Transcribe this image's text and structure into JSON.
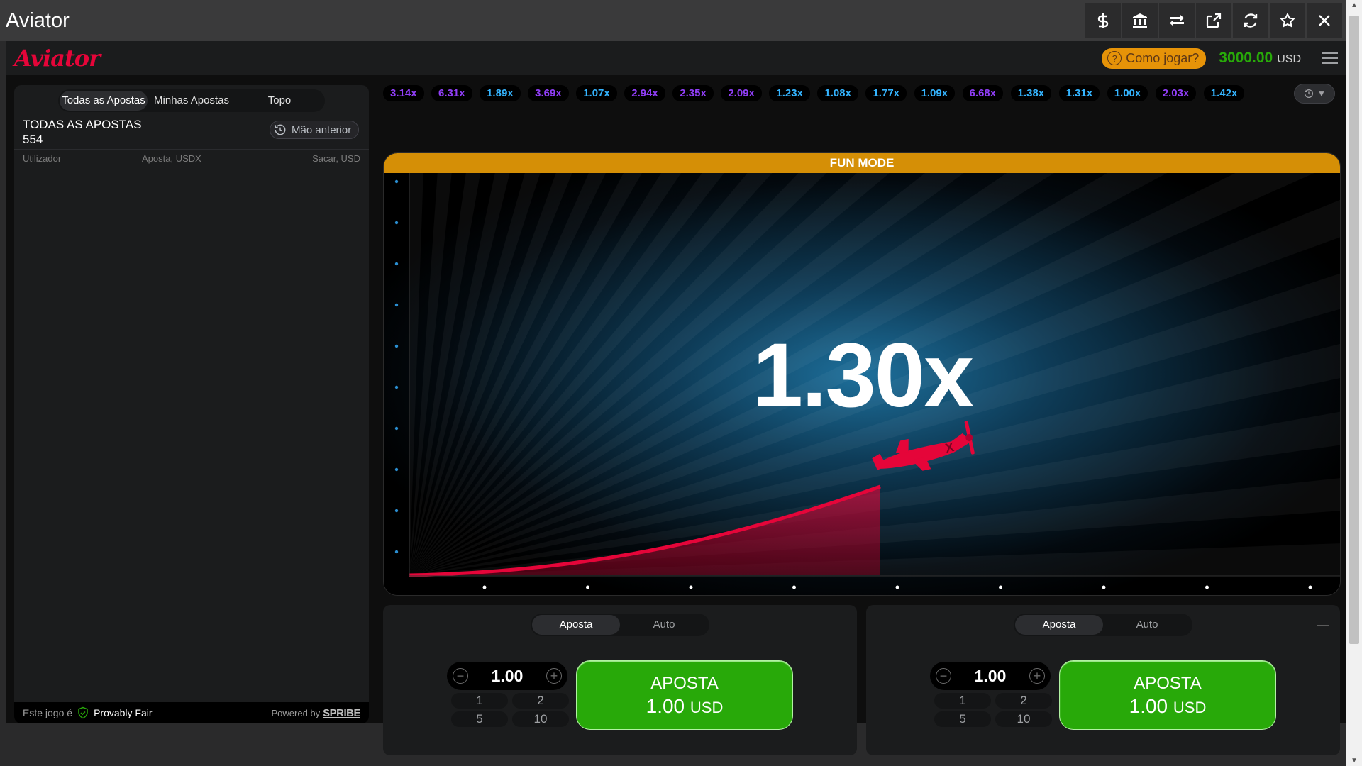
{
  "window": {
    "title": "Aviator",
    "actions": [
      "dollar-icon",
      "bank-icon",
      "swap-icon",
      "external-link-icon",
      "refresh-icon",
      "star-icon",
      "close-icon"
    ]
  },
  "header": {
    "logo": "Aviator",
    "how_to_play": "Como jogar?",
    "balance": "3000.00",
    "currency": "USD"
  },
  "left_panel": {
    "tabs": [
      {
        "label": "Todas as Apostas",
        "active": true
      },
      {
        "label": "Minhas Apostas",
        "active": false
      },
      {
        "label": "Topo",
        "active": false
      }
    ],
    "title": "TODAS AS APOSTAS",
    "count": "554",
    "prev_hand": "Mão anterior",
    "columns": [
      "Utilizador",
      "Aposta, USD",
      "X",
      "Sacar, USD"
    ],
    "footer": {
      "provably_prefix": "Este jogo é",
      "provably": "Provably Fair",
      "powered_by": "Powered by",
      "brand": "SPRIBE"
    }
  },
  "history": [
    {
      "value": "3.14x",
      "color": "#913ef8"
    },
    {
      "value": "6.31x",
      "color": "#913ef8"
    },
    {
      "value": "1.89x",
      "color": "#34b4ff"
    },
    {
      "value": "3.69x",
      "color": "#913ef8"
    },
    {
      "value": "1.07x",
      "color": "#34b4ff"
    },
    {
      "value": "2.94x",
      "color": "#913ef8"
    },
    {
      "value": "2.35x",
      "color": "#913ef8"
    },
    {
      "value": "2.09x",
      "color": "#913ef8"
    },
    {
      "value": "1.23x",
      "color": "#34b4ff"
    },
    {
      "value": "1.08x",
      "color": "#34b4ff"
    },
    {
      "value": "1.77x",
      "color": "#34b4ff"
    },
    {
      "value": "1.09x",
      "color": "#34b4ff"
    },
    {
      "value": "6.68x",
      "color": "#913ef8"
    },
    {
      "value": "1.38x",
      "color": "#34b4ff"
    },
    {
      "value": "1.31x",
      "color": "#34b4ff"
    },
    {
      "value": "1.00x",
      "color": "#34b4ff"
    },
    {
      "value": "2.03x",
      "color": "#913ef8"
    },
    {
      "value": "1.42x",
      "color": "#34b4ff"
    }
  ],
  "game": {
    "mode_label": "FUN MODE",
    "multiplier": "1.30x",
    "accent": "#e50539"
  },
  "bet_panels": [
    {
      "tabs": [
        "Aposta",
        "Auto"
      ],
      "amount": "1.00",
      "quick": [
        "1",
        "2",
        "5",
        "10"
      ],
      "button_label": "APOSTA",
      "button_amount": "1.00",
      "button_currency": "USD"
    },
    {
      "tabs": [
        "Aposta",
        "Auto"
      ],
      "amount": "1.00",
      "quick": [
        "1",
        "2",
        "5",
        "10"
      ],
      "button_label": "APOSTA",
      "button_amount": "1.00",
      "button_currency": "USD"
    }
  ]
}
